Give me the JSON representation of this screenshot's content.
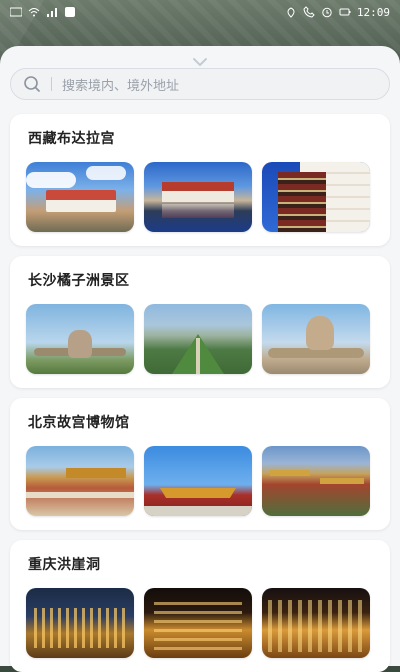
{
  "status_bar": {
    "time": "12:09",
    "left_icons": [
      "hd-icon",
      "wifi-icon",
      "signal-icon",
      "app-icon"
    ],
    "right_icons": [
      "location-icon",
      "phone-icon",
      "alarm-icon",
      "battery-icon"
    ]
  },
  "search": {
    "placeholder": "搜索境内、境外地址"
  },
  "sections": [
    {
      "title": "西藏布达拉宫"
    },
    {
      "title": "长沙橘子洲景区"
    },
    {
      "title": "北京故宫博物馆"
    },
    {
      "title": "重庆洪崖洞"
    }
  ],
  "colors": {
    "sheet_bg": "#f5f6f8",
    "card_bg": "#ffffff",
    "search_text": "#9aa1aa",
    "title_text": "#222222"
  }
}
